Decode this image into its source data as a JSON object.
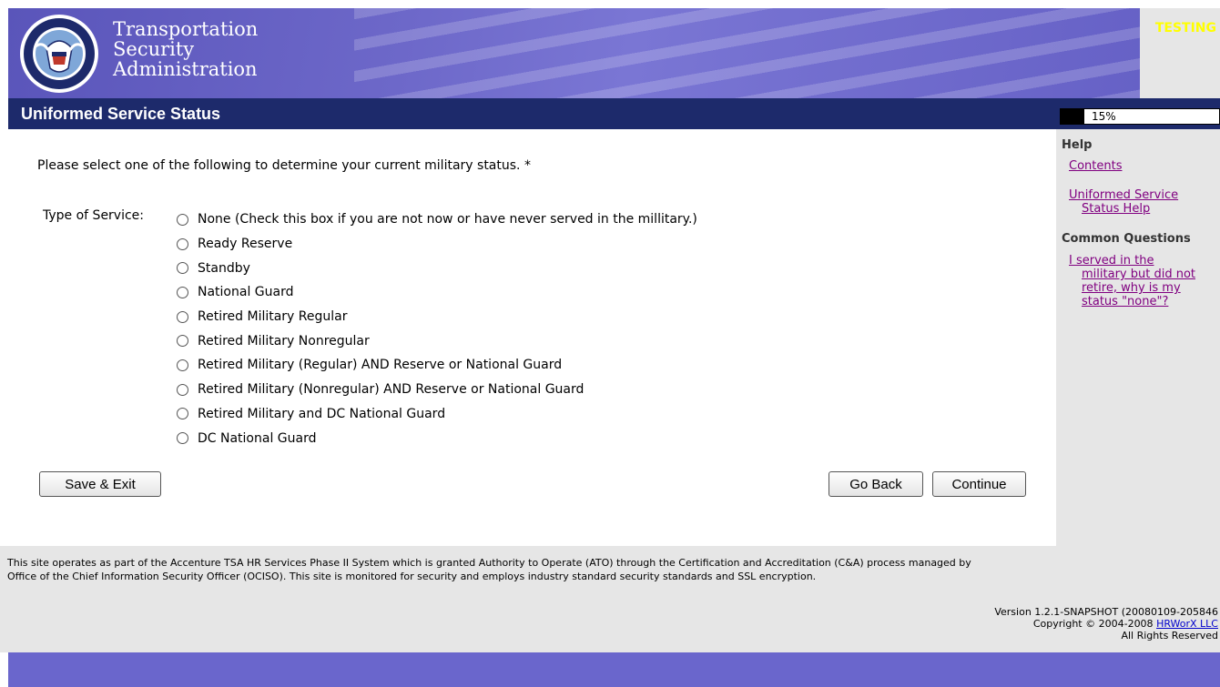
{
  "header": {
    "org_line1": "Transportation",
    "org_line2": "Security",
    "org_line3": "Administration",
    "env_label": "TESTING"
  },
  "page_title": "Uniformed Service Status",
  "progress": {
    "label": "15%",
    "value": 0.15
  },
  "form": {
    "instruction": "Please select one of the following to determine your current military status. *",
    "type_label": "Type of Service:",
    "options": [
      "None (Check this box if you are not now or have never served in the millitary.)",
      "Ready Reserve",
      "Standby",
      "National Guard",
      "Retired Military Regular",
      "Retired Military Nonregular",
      "Retired Military (Regular) AND Reserve or National Guard",
      "Retired Military (Nonregular) AND Reserve or National Guard",
      "Retired Military and DC National Guard",
      "DC National Guard"
    ]
  },
  "buttons": {
    "save_exit": "Save & Exit",
    "go_back": "Go Back",
    "continue": "Continue"
  },
  "sidebar": {
    "help_heading": "Help",
    "contents": "Contents",
    "service_help_1": "Uniformed Service",
    "service_help_2": "Status Help",
    "common_heading": "Common Questions",
    "q1_1": "I served in the",
    "q1_2": "military but did not",
    "q1_3": "retire, why is my",
    "q1_4": "status \"none\"?"
  },
  "footer": {
    "notice_1": "This site operates as part of the Accenture TSA HR Services Phase II System which is granted Authority to Operate (ATO) through the Certification and Accreditation (C&A) process managed by",
    "notice_2": "Office of the Chief Information Security Officer (OCISO). This site is monitored for security and employs industry standard security standards and SSL encryption.",
    "version": "Version 1.2.1-SNAPSHOT (20080109-205846",
    "copyright": "Copyright © 2004-2008",
    "company": "HRWorX LLC",
    "rights": "All Rights Reserved"
  },
  "colors": {
    "banner": "#6a66cc",
    "title_bar": "#1d2a6b",
    "sidebar": "#e6e6e6",
    "link": "#800080",
    "testing": "#ffff00"
  }
}
